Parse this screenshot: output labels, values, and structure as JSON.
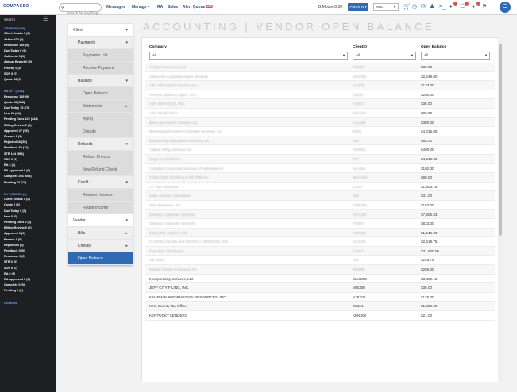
{
  "topbar": {
    "logo": "COMPASSO",
    "search_placeholder": "Search for anything...",
    "nav": [
      "Messages",
      "Manage ▾",
      "RA",
      "Sales",
      "Alert Queue"
    ],
    "alert_count": "259",
    "user_text": "B.Moore 0:00",
    "punch_label": "Punch in ▾",
    "misc_select": "Misc",
    "icons": [
      "cart-icon",
      "clock-icon",
      "chat-icon",
      "users-icon",
      "terminal-icon",
      "bell-icon",
      "tasks-icon",
      "toggle-icon"
    ],
    "menu_icon": "☰"
  },
  "leftbar": {
    "header": "Search",
    "sections": [
      {
        "title": "ORDERS (689)",
        "items": [
          "Client Emails  1 (0)",
          "Active  470 (0)",
          "Response  129 (0)",
          "Due Today  0 (0)",
          "California  0 (0)",
          "Annual Report  0 (0)",
          "Priority  0 (0)",
          "SOP  3 (0)",
          "Quote  56 (0)"
        ]
      },
      {
        "title": "ENTITY (1106)",
        "items": [
          "Response  129 (0)",
          "Quote  56 (538)",
          "Due Today  15 (73)",
          "New  22 (34)",
          "Pending Docs  122 (244)",
          "Billing Review  2 (2)",
          "Approved  27 (55)",
          "Rework  1 (1)",
          "Rejected  16 (55)",
          "Feedback  65 (74)",
          "STR  144 (586)",
          "SOP  0 (0)",
          "RA  3 (4)",
          "RA Approved  0 (0)",
          "Complete  266 (603)",
          "Pending  73 (72)"
        ]
      },
      {
        "title": "MY ORDERS (0)",
        "items": [
          "Client Emails  0 (0)",
          "Quote  0 (0)",
          "Due Today  0 (0)",
          "New  0 (0)",
          "Pending Docs  0 (0)",
          "Billing Review  0 (0)",
          "Approved  0 (0)",
          "Rework  0 (0)",
          "Rejected  0 (0)",
          "Feedback  0 (0)",
          "Response  0 (0)",
          "STR  0 (0)",
          "SOP  0 (0)",
          "RA  0 (0)",
          "RA Approved  0 (0)",
          "Complete  0 (0)",
          "Pending  0 (0)"
        ]
      },
      {
        "title": "ORDERS",
        "items": []
      }
    ]
  },
  "submenu": [
    {
      "label": "Client",
      "kind": "top",
      "arrow": "▾"
    },
    {
      "label": "Payments",
      "kind": "grp",
      "arrow": "▾"
    },
    {
      "label": "Payments List",
      "kind": "sub"
    },
    {
      "label": "Receive Payment",
      "kind": "sub"
    },
    {
      "label": "Balance",
      "kind": "grp",
      "arrow": "▾"
    },
    {
      "label": "Open Balance",
      "kind": "sub"
    },
    {
      "label": "Statements",
      "kind": "sub",
      "arrow": "▸"
    },
    {
      "label": "Aging",
      "kind": "sub"
    },
    {
      "label": "Dispute",
      "kind": "sub"
    },
    {
      "label": "Refunds",
      "kind": "grp",
      "arrow": "▾"
    },
    {
      "label": "Refund Checks",
      "kind": "sub"
    },
    {
      "label": "New Refund Check",
      "kind": "sub"
    },
    {
      "label": "Credit",
      "kind": "grp",
      "arrow": "▾"
    },
    {
      "label": "Retained Income",
      "kind": "sub"
    },
    {
      "label": "Retain Income",
      "kind": "sub"
    },
    {
      "label": "Vendor",
      "kind": "top",
      "arrow": "▾"
    },
    {
      "label": "Bills",
      "kind": "grp",
      "arrow": "▸"
    },
    {
      "label": "Checks",
      "kind": "grp",
      "arrow": "▸"
    },
    {
      "label": "Open Balance",
      "kind": "active"
    }
  ],
  "page": {
    "title": "ACCOUNTING | VENDOR OPEN BALANCE"
  },
  "table": {
    "headers": [
      "Company",
      "ClientID",
      "Open Balance"
    ],
    "filters": [
      "All",
      "All",
      "All"
    ],
    "rows": [
      {
        "company": "Amigent Services, LLC",
        "client_id": "PR200",
        "balance": "$30.00",
        "obscured": true
      },
      {
        "company": "Advanced Corporate Agent Services",
        "client_id": "ADV300",
        "balance": "$2,249.00",
        "obscured": true
      },
      {
        "company": "ABC Information Services Inc.",
        "client_id": "CA278",
        "balance": "$133.00",
        "obscured": true
      },
      {
        "company": "Arizona Statutory Agent, LLC",
        "client_id": "AZ200",
        "balance": "$250.00",
        "obscured": true
      },
      {
        "company": "ASK SERVICES, INC.",
        "client_id": "AS201",
        "balance": "$35.00",
        "obscured": true
      },
      {
        "company": "ASK RESEARCH",
        "client_id": "DEC200",
        "balance": "$95.00",
        "obscured": true
      },
      {
        "company": "Best Law Search Service LLC",
        "client_id": "CAL300",
        "balance": "$380.00",
        "obscured": true
      },
      {
        "company": "Bloomberg/Excelsior Corporate Services, Inc.",
        "client_id": "BS01",
        "balance": "$4,015.00",
        "obscured": true
      },
      {
        "company": "Boomerang Information Services, Inc.",
        "client_id": "249",
        "balance": "$65.00",
        "obscured": true
      },
      {
        "company": "Capital Filing Services Inc.",
        "client_id": "TEN001",
        "balance": "$490.00",
        "obscured": true
      },
      {
        "company": "Cogency Global Inc.",
        "client_id": "247",
        "balance": "$4,216.00",
        "obscured": true
      },
      {
        "company": "Complete Corporate Services of Nebraska Inc.",
        "client_id": "ALA302",
        "balance": "$102.30",
        "obscured": true
      },
      {
        "company": "CONCORD SEARCH & RETRIEVAL",
        "client_id": "WHA200",
        "balance": "$80.00",
        "obscured": true
      },
      {
        "company": "CT Lien Solutions",
        "client_id": "IL200",
        "balance": "$1,905.15",
        "obscured": true
      },
      {
        "company": "Daily Journal Corporation",
        "client_id": "209",
        "balance": "$31.00",
        "obscured": true
      },
      {
        "company": "Data Research, Inc.",
        "client_id": "ORE300",
        "balance": "$153.00",
        "obscured": true
      },
      {
        "company": "Delaney Corporate Services",
        "client_id": "NYC300",
        "balance": "$7,556.53",
        "obscured": true
      },
      {
        "company": "Delaney Corporate Services",
        "client_id": "TX200",
        "balance": "$823.00",
        "obscured": true
      },
      {
        "company": "ESQUIRE ASSIST LTD.",
        "client_id": "PEN300",
        "balance": "$1,046.00",
        "obscured": true
      },
      {
        "company": "FLORIDA FILING and SEARCH SERVICES, INC.",
        "client_id": "FLO300",
        "balance": "$2,618.75",
        "obscured": true
      },
      {
        "company": "Franchise Tax Board",
        "client_id": "CA047",
        "balance": "$31,600.00",
        "obscured": true
      },
      {
        "company": "HB Direct",
        "client_id": "200",
        "balance": "$245.75",
        "obscured": true
      },
      {
        "company": "Hubbel Search Company, Inc.",
        "client_id": "MO300",
        "balance": "$255.00",
        "obscured": true
      },
      {
        "company": "Incorporating Services, Ltd.",
        "client_id": "WAS304",
        "balance": "$3,380.18",
        "obscured": false
      },
      {
        "company": "JEFF CITY FILING, INC.",
        "client_id": "MIS306",
        "balance": "$35.00",
        "obscured": false
      },
      {
        "company": "KAUFMAN INFORMATION RESOURCES, INC.",
        "client_id": "NJE300",
        "balance": "$125.00",
        "obscured": false
      },
      {
        "company": "Kent County Tax Office",
        "client_id": "DE211",
        "balance": "$1,680.96",
        "obscured": false
      },
      {
        "company": "KENTUCKY LENDERS",
        "client_id": "KEN300",
        "balance": "$21.00",
        "obscured": false
      }
    ]
  }
}
